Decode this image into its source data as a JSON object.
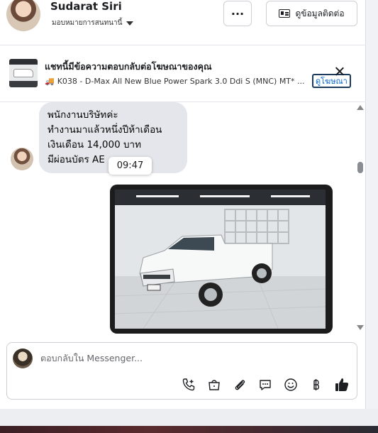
{
  "header": {
    "name": "Sudarat Siri",
    "assign_label": "มอบหมายการสนทนานี้",
    "more_label": "···",
    "contact_label": "ดูข้อมูลติดต่อ"
  },
  "ad_banner": {
    "title": "แชทนี้มีข้อความตอบกลับต่อโฆษณาของคุณ",
    "subtitle": "K038 - D-Max All New Blue Power Spark 3.0 Ddi S (MNC) MT* ...",
    "link_label": "ดูโฆษณา"
  },
  "messages": {
    "incoming_lines": [
      "พนักงานบริษัทค่ะ",
      "ทำงานมาแล้วหนึ่งปีห้าเดือน",
      "เงินเดือน 14,000 บาท",
      "มีผ่อนบัตร AE"
    ],
    "time_tooltip": "09:47"
  },
  "composer": {
    "placeholder": "ตอบกลับใน Messenger..."
  },
  "icons": [
    "phone-plus-icon",
    "shopping-bag-icon",
    "paperclip-icon",
    "saved-reply-icon",
    "emoji-icon",
    "baht-icon",
    "thumbs-up-icon"
  ],
  "colors": {
    "accent": "#0064d1",
    "bubble": "#e4e6eb",
    "like": "#1c1e21"
  }
}
